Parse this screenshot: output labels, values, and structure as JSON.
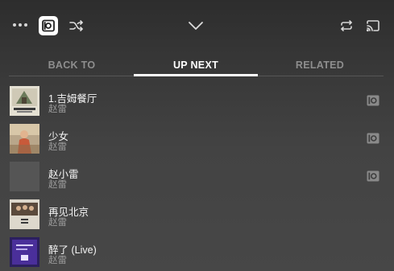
{
  "header": {
    "more_icon": "more-horizontal-icon",
    "player_icon": "now-playing-icon",
    "shuffle_icon": "shuffle-icon",
    "collapse_icon": "chevron-down-icon",
    "repeat_icon": "repeat-icon",
    "cast_icon": "cast-icon"
  },
  "tabs": [
    {
      "label": "BACK TO",
      "active": false
    },
    {
      "label": "UP NEXT",
      "active": true
    },
    {
      "label": "RELATED",
      "active": false
    }
  ],
  "queue": [
    {
      "title": "1.吉姆餐厅",
      "artist": "赵雷",
      "thumb_art": "album-art-jim-restaurant",
      "has_player_icon": true
    },
    {
      "title": "少女",
      "artist": "赵雷",
      "thumb_art": "album-art-girl",
      "has_player_icon": true
    },
    {
      "title": "赵小雷",
      "artist": "赵雷",
      "thumb_art": "placeholder-art",
      "has_player_icon": true
    },
    {
      "title": "再见北京",
      "artist": "赵雷",
      "thumb_art": "album-art-goodbye-beijing",
      "has_player_icon": false
    },
    {
      "title": "醉了 (Live)",
      "artist": "赵雷",
      "thumb_art": "album-art-live",
      "has_player_icon": false
    }
  ],
  "colors": {
    "background_top": "#2d2d2d",
    "background_bottom": "#474747",
    "active_tab": "#ffffff",
    "inactive_tab": "#8e8e8e",
    "title_text": "#f4f4f4",
    "artist_text": "#9b9b9b"
  }
}
